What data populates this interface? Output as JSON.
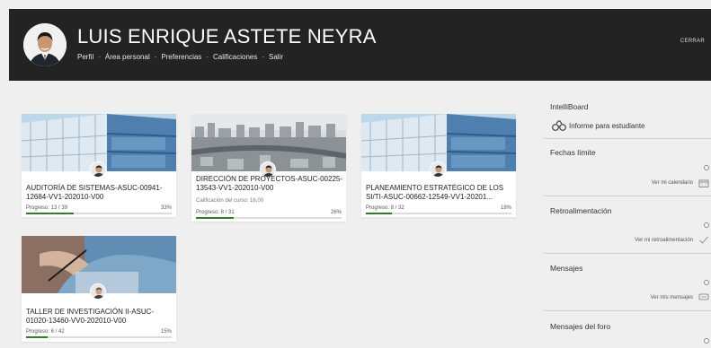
{
  "header": {
    "user_name": "LUIS ENRIQUE ASTETE NEYRA",
    "nav": [
      "Perfil",
      "Área personal",
      "Preferencias",
      "Calificaciones",
      "Salir"
    ],
    "separator": "-",
    "logout": "CERRAR"
  },
  "courses": [
    {
      "title": "AUDITORÍA DE SISTEMAS-ASUC-00941-12684-VV1-202010-V00",
      "grade": "",
      "progress_label": "Progreso: 13 / 39",
      "progress_pct": "33%",
      "progress_value": 0.33,
      "image_icon": "building-photo"
    },
    {
      "title": "DIRECCIÓN DE PROYECTOS-ASUC-00225-13543-VV1-202010-V00",
      "grade": "Calificación del curso: 16,00",
      "progress_label": "Progreso: 8 / 31",
      "progress_pct": "26%",
      "progress_value": 0.26,
      "image_icon": "city-photo"
    },
    {
      "title": "PLANEAMIENTO ESTRATÉGICO DE LOS SI/TI-ASUC-00662-12549-VV1-20201...",
      "grade": "",
      "progress_label": "Progreso: 8 / 32",
      "progress_pct": "18%",
      "progress_value": 0.18,
      "image_icon": "building-photo"
    },
    {
      "title": "TALLER DE INVESTIGACIÓN II-ASUC-01020-13460-VV0-202010-V00",
      "grade": "",
      "progress_label": "Progreso: 6 / 42",
      "progress_pct": "15%",
      "progress_value": 0.15,
      "image_icon": "writing-photo"
    }
  ],
  "sidebar": {
    "intelliboard_title": "IntelliBoard",
    "intelliboard_link": "Informe para estudiante",
    "deadlines_title": "Fechas límite",
    "deadlines_link": "Ver mi calendario",
    "feedback_title": "Retroalimentación",
    "feedback_link": "Ver mi retroalimentación",
    "messages_title": "Mensajes",
    "messages_link": "Ver mis mensajes",
    "forum_title": "Mensajes del foro"
  },
  "colors": {
    "header_bg": "#232323",
    "progress": "#2f7d2a",
    "page_bg": "#efefef"
  }
}
